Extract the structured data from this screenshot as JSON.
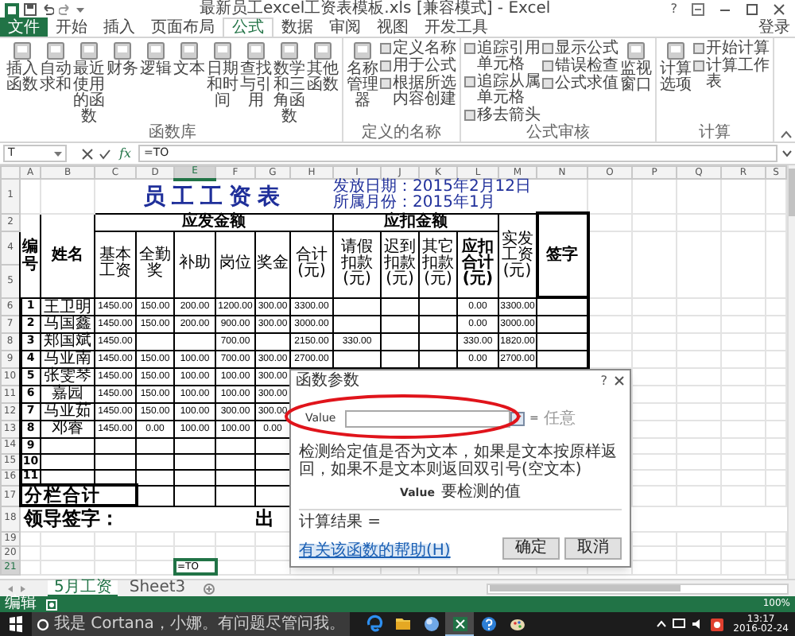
{
  "title_bar": {
    "title": "最新员工excel工资表模板.xls  [兼容模式] - Excel",
    "help": "?"
  },
  "ribbon_tabs": [
    {
      "label": "文件",
      "kind": "file",
      "selected": false
    },
    {
      "label": "开始",
      "kind": "tab",
      "selected": false
    },
    {
      "label": "插入",
      "kind": "tab",
      "selected": false
    },
    {
      "label": "页面布局",
      "kind": "tab",
      "selected": false
    },
    {
      "label": "公式",
      "kind": "tab",
      "selected": true
    },
    {
      "label": "数据",
      "kind": "tab",
      "selected": false
    },
    {
      "label": "审阅",
      "kind": "tab",
      "selected": false
    },
    {
      "label": "视图",
      "kind": "tab",
      "selected": false
    },
    {
      "label": "开发工具",
      "kind": "tab",
      "selected": false
    }
  ],
  "sign_in": "登录",
  "ribbon_groups": [
    {
      "label": "函数库",
      "items": [
        {
          "kind": "large",
          "label": "插入函数"
        },
        {
          "kind": "large",
          "label": "自动求和"
        },
        {
          "kind": "large",
          "label": "最近使用的函数"
        },
        {
          "kind": "large",
          "label": "财务"
        },
        {
          "kind": "large",
          "label": "逻辑"
        },
        {
          "kind": "large",
          "label": "文本"
        },
        {
          "kind": "large",
          "label": "日期和时间"
        },
        {
          "kind": "large",
          "label": "查找与引用"
        },
        {
          "kind": "large",
          "label": "数学和三角函数"
        },
        {
          "kind": "large",
          "label": "其他函数"
        }
      ]
    },
    {
      "label": "定义的名称",
      "items": [
        {
          "kind": "large",
          "label": "名称管理器"
        },
        {
          "kind": "small",
          "label": "定义名称"
        },
        {
          "kind": "small",
          "label": "用于公式"
        },
        {
          "kind": "small",
          "label": "根据所选内容创建"
        }
      ]
    },
    {
      "label": "公式审核",
      "items": [
        {
          "kind": "small",
          "label": "追踪引用单元格"
        },
        {
          "kind": "small",
          "label": "追踪从属单元格"
        },
        {
          "kind": "small",
          "label": "移去箭头"
        },
        {
          "kind": "small",
          "label": "显示公式"
        },
        {
          "kind": "small",
          "label": "错误检查"
        },
        {
          "kind": "small",
          "label": "公式求值"
        },
        {
          "kind": "large",
          "label": "监视窗口"
        }
      ]
    },
    {
      "label": "计算",
      "items": [
        {
          "kind": "large",
          "label": "计算选项"
        },
        {
          "kind": "small",
          "label": "开始计算"
        },
        {
          "kind": "small",
          "label": "计算工作表"
        }
      ]
    }
  ],
  "formula_bar": {
    "name_box": "T",
    "fx": "fx",
    "formula": "=TO"
  },
  "sheet": {
    "columns": [
      {
        "letter": "A",
        "selected": false
      },
      {
        "letter": "B",
        "selected": false
      },
      {
        "letter": "C",
        "selected": false
      },
      {
        "letter": "D",
        "selected": false
      },
      {
        "letter": "E",
        "selected": true
      },
      {
        "letter": "F",
        "selected": false
      },
      {
        "letter": "G",
        "selected": false
      },
      {
        "letter": "H",
        "selected": false
      },
      {
        "letter": "I",
        "selected": false
      },
      {
        "letter": "J",
        "selected": false
      },
      {
        "letter": "K",
        "selected": false
      },
      {
        "letter": "L",
        "selected": false
      },
      {
        "letter": "M",
        "selected": false
      },
      {
        "letter": "N",
        "selected": false
      },
      {
        "letter": "O",
        "selected": false
      },
      {
        "letter": "P",
        "selected": false
      },
      {
        "letter": "Q",
        "selected": false
      },
      {
        "letter": "R",
        "selected": false
      },
      {
        "letter": "S",
        "selected": false
      }
    ],
    "header_rows": [
      "1",
      "2",
      "4",
      "5"
    ],
    "title": "员工工资表",
    "issue_date": "发放日期：2015年2月12日",
    "month": "所属月份：2015年1月",
    "number_header": "编号",
    "name_header": "姓名",
    "payable_group": "应发金额",
    "deduction_group": "应扣金额",
    "payable_columns": [
      "基本工资",
      "全勤奖",
      "补助",
      "岗位",
      "奖金",
      "合计(元)"
    ],
    "deduction_columns": [
      "请假扣款(元)",
      "迟到扣款(元)",
      "其它扣款(元)",
      "应扣合计(元)"
    ],
    "net_pay_header": "实发工资(元)",
    "signature_header": "签字",
    "employees": [
      {
        "row": "6",
        "no": "1",
        "name": "王卫明",
        "cells": [
          "1450.00",
          "150.00",
          "200.00",
          "1200.00",
          "300.00",
          "3300.00",
          "",
          "",
          "",
          "0.00",
          "3300.00"
        ]
      },
      {
        "row": "7",
        "no": "2",
        "name": "马国鑫",
        "cells": [
          "1450.00",
          "150.00",
          "200.00",
          "900.00",
          "300.00",
          "3000.00",
          "",
          "",
          "",
          "0.00",
          "3000.00"
        ]
      },
      {
        "row": "8",
        "no": "3",
        "name": "郑国斌",
        "cells": [
          "1450.00",
          "",
          "",
          "700.00",
          "",
          "2150.00",
          "330.00",
          "",
          "",
          "330.00",
          "1820.00"
        ]
      },
      {
        "row": "9",
        "no": "4",
        "name": "马亚南",
        "cells": [
          "1450.00",
          "150.00",
          "100.00",
          "700.00",
          "300.00",
          "2700.00",
          "",
          "",
          "",
          "0.00",
          "2700.00"
        ]
      },
      {
        "row": "10",
        "no": "5",
        "name": "张雯琴",
        "cells": [
          "1450.00",
          "150.00",
          "100.00",
          "100.00",
          "300.00"
        ]
      },
      {
        "row": "11",
        "no": "6",
        "name": "嘉园",
        "cells": [
          "1450.00",
          "150.00",
          "100.00",
          "100.00",
          "300.00"
        ]
      },
      {
        "row": "12",
        "no": "7",
        "name": "马亚茹",
        "cells": [
          "1450.00",
          "150.00",
          "100.00",
          "300.00",
          "300.00"
        ]
      },
      {
        "row": "13",
        "no": "8",
        "name": "邓睿",
        "cells": [
          "1450.00",
          "0.00",
          "100.00",
          "100.00",
          "0.00"
        ]
      },
      {
        "row": "14",
        "no": "9"
      },
      {
        "row": "15",
        "no": "10"
      },
      {
        "row": "16",
        "no": "11"
      }
    ],
    "total_row": {
      "row": "17",
      "label": "分栏合计"
    },
    "sign_row": {
      "row": "18",
      "left": "领导签字：",
      "middle": "出"
    },
    "blank_rows": [
      {
        "row": "19",
        "selected": false
      },
      {
        "row": "20",
        "selected": false
      },
      {
        "row": "21",
        "selected": true,
        "active_value": "=TO"
      }
    ]
  },
  "dialog": {
    "title": "函数参数",
    "help": "?",
    "arg_label": "Value",
    "arg_equals": "=",
    "arg_result": "任意",
    "description": "检测给定值是否为文本，如果是文本按原样返回，如果不是文本则返回双引号(空文本)",
    "param_name": "Value",
    "param_desc": "要检测的值",
    "result_label": "计算结果 =",
    "help_link": "有关该函数的帮助(H)",
    "buttons": [
      "确定",
      "取消"
    ]
  },
  "sheet_tabs": [
    {
      "label": "5月工资",
      "selected": true
    },
    {
      "label": "Sheet3",
      "selected": false
    }
  ],
  "status_bar": {
    "mode": "编辑",
    "zoom": "100%"
  },
  "taskbar": {
    "search": "我是 Cortana，小娜。有问题尽管问我。",
    "apps": [
      {
        "kind": "edge",
        "active": false
      },
      {
        "kind": "folder",
        "active": false
      },
      {
        "kind": "globe",
        "active": false
      },
      {
        "kind": "excel",
        "active": true
      },
      {
        "kind": "help",
        "active": false
      },
      {
        "kind": "paint",
        "active": false
      }
    ],
    "time": "13:17",
    "date": "2016-02-24"
  }
}
